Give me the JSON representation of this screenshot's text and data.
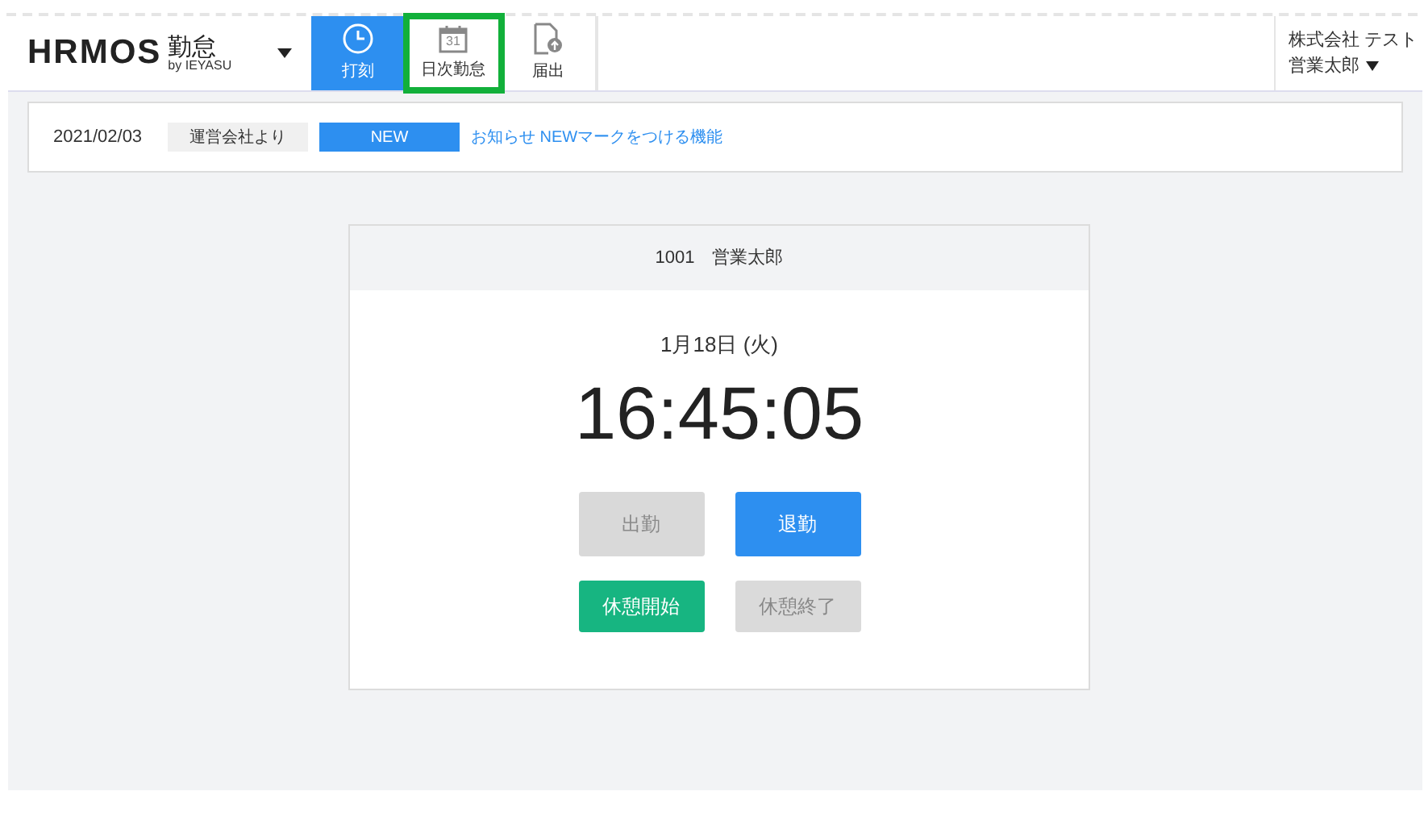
{
  "header": {
    "logo": "HRMOS",
    "product": "勤怠",
    "byline": "by IEYASU",
    "tabs": [
      {
        "label": "打刻",
        "kind": "clock",
        "selected": true,
        "highlighted": false
      },
      {
        "label": "日次勤怠",
        "kind": "calendar",
        "calendar_day": "31",
        "selected": false,
        "highlighted": true
      },
      {
        "label": "届出",
        "kind": "document",
        "selected": false,
        "highlighted": false
      }
    ],
    "user": {
      "company": "株式会社 テスト",
      "name": "営業太郎"
    }
  },
  "notice": {
    "date": "2021/02/03",
    "source": "運営会社より",
    "badge": "NEW",
    "link": "お知らせ NEWマークをつける機能"
  },
  "punch_card": {
    "employee": "1001　営業太郎",
    "date": "1月18日 (火)",
    "time": "16:45:05",
    "buttons": [
      {
        "label": "出勤",
        "kind": "primary",
        "disabled": true
      },
      {
        "label": "退勤",
        "kind": "primary",
        "disabled": false
      },
      {
        "label": "休憩開始",
        "kind": "success",
        "disabled": false
      },
      {
        "label": "休憩終了",
        "kind": "success",
        "disabled": true
      }
    ]
  }
}
